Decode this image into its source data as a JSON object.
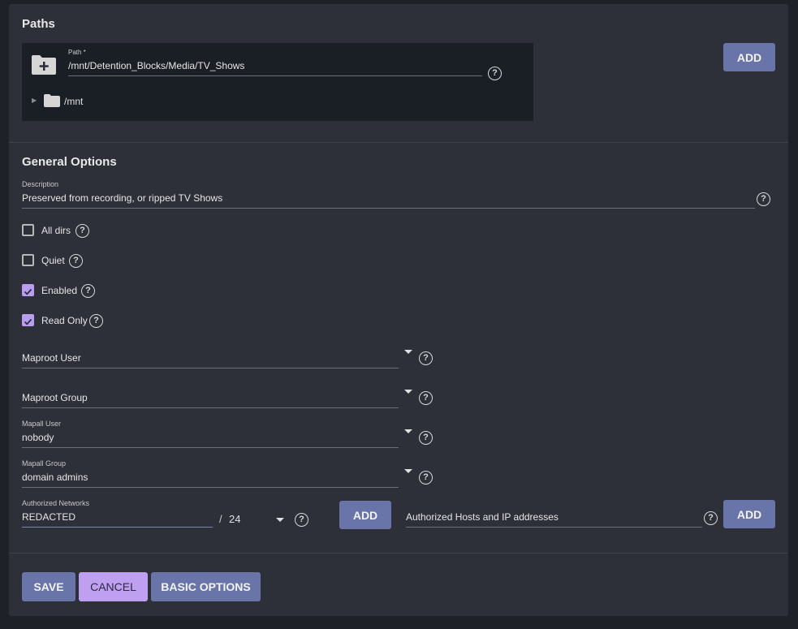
{
  "paths": {
    "title": "Paths",
    "path_label": "Path *",
    "path_value": "/mnt/Detention_Blocks/Media/TV_Shows",
    "tree_root": "/mnt",
    "add_label": "ADD"
  },
  "general": {
    "title": "General Options",
    "description_label": "Description",
    "description_value": "Preserved from recording, or ripped TV Shows",
    "checkboxes": [
      {
        "label": "All dirs",
        "checked": false
      },
      {
        "label": "Quiet",
        "checked": false
      },
      {
        "label": "Enabled",
        "checked": true
      },
      {
        "label": "Read Only",
        "checked": true
      }
    ],
    "maproot_user_placeholder": "Maproot User",
    "maproot_group_placeholder": "Maproot Group",
    "mapall_user_label": "Mapall User",
    "mapall_user_value": "nobody",
    "mapall_group_label": "Mapall Group",
    "mapall_group_value": "domain admins",
    "networks_label": "Authorized Networks",
    "networks_value": "REDACTED",
    "mask_separator": "/",
    "mask_value": "24",
    "networks_add_label": "ADD",
    "hosts_placeholder": "Authorized Hosts and IP addresses",
    "hosts_add_label": "ADD"
  },
  "actions": {
    "save": "SAVE",
    "cancel": "CANCEL",
    "basic": "BASIC OPTIONS"
  },
  "help_glyph": "?",
  "tree_arrow": "▶",
  "colors": {
    "accent": "#6974a8",
    "checked": "#b99ef0",
    "background": "#2d2f39"
  }
}
